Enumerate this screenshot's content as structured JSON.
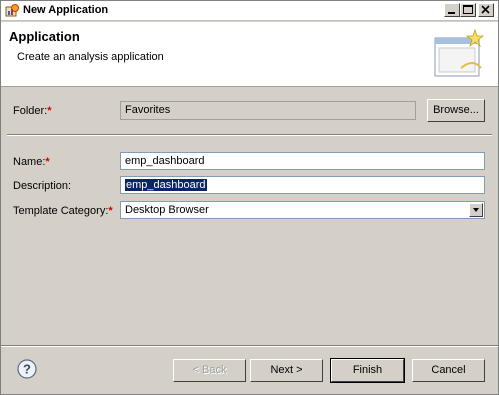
{
  "window": {
    "title": "New Application"
  },
  "header": {
    "title": "Application",
    "subtitle": "Create an analysis application"
  },
  "form": {
    "folder_label": "Folder:",
    "folder_value": "Favorites",
    "browse_label": "Browse...",
    "name_label": "Name:",
    "name_value": "emp_dashboard",
    "description_label": "Description:",
    "description_value": "emp_dashboard",
    "template_label": "Template Category:",
    "template_value": "Desktop Browser",
    "required_marker": "*"
  },
  "buttons": {
    "back": "< Back",
    "next": "Next >",
    "finish": "Finish",
    "cancel": "Cancel"
  },
  "colors": {
    "accent_selection": "#0a246a",
    "required": "#d00000"
  }
}
